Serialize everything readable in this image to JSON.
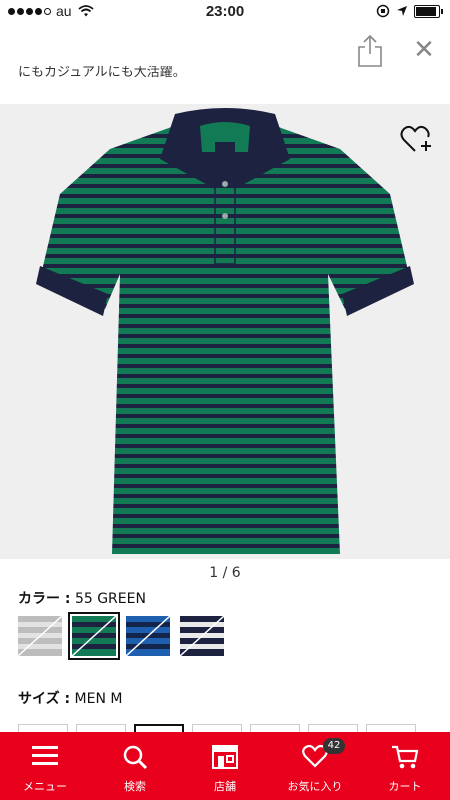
{
  "status_bar": {
    "carrier": "au",
    "time": "23:00",
    "battery_level": 0.85
  },
  "toolbar": {
    "share_icon": "share-icon",
    "close_icon": "close-icon",
    "close_glyph": "✕"
  },
  "description_snippet": "にもカジュアルにも大活躍。",
  "product": {
    "image_subject": "green navy striped polo shirt",
    "colors": {
      "green": "#127a55",
      "navy": "#1c2240",
      "background": "#efefef"
    },
    "favorite_icon": "heart-plus-icon"
  },
  "pager": {
    "text": "1 / 6"
  },
  "color_label": {
    "key": "カラー :",
    "value": "55 GREEN"
  },
  "swatches": [
    {
      "name": "gray",
      "selected": false
    },
    {
      "name": "green",
      "selected": true
    },
    {
      "name": "blue",
      "selected": false
    },
    {
      "name": "navy",
      "selected": false
    }
  ],
  "size_label": {
    "key": "サイズ :",
    "value": "MEN M"
  },
  "bottom_nav": {
    "accent": "#e8001c",
    "items": [
      {
        "label": "メニュー",
        "icon": "menu-icon"
      },
      {
        "label": "検索",
        "icon": "search-icon"
      },
      {
        "label": "店舗",
        "icon": "store-icon"
      },
      {
        "label": "お気に入り",
        "icon": "heart-icon",
        "badge": "42"
      },
      {
        "label": "カート",
        "icon": "cart-icon"
      }
    ]
  }
}
